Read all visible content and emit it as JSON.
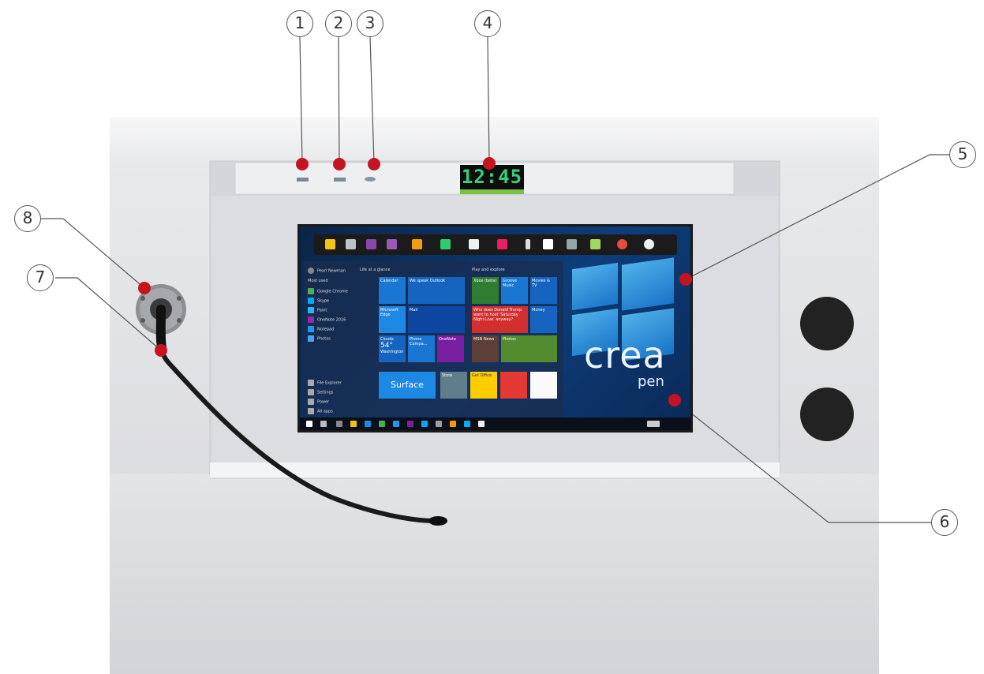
{
  "callouts": [
    {
      "id": "1",
      "label": "1"
    },
    {
      "id": "2",
      "label": "2"
    },
    {
      "id": "3",
      "label": "3"
    },
    {
      "id": "4",
      "label": "4"
    },
    {
      "id": "5",
      "label": "5"
    },
    {
      "id": "6",
      "label": "6"
    },
    {
      "id": "7",
      "label": "7"
    },
    {
      "id": "8",
      "label": "8"
    }
  ],
  "clock": {
    "time": "12:45"
  },
  "screen": {
    "brand_main": "crea",
    "brand_sub": "pen",
    "tiles": {
      "outlook": "We speak Outlook",
      "calendar": "Calendar",
      "mail": "Mail",
      "edge": "Microsoft Edge",
      "surface": "Surface",
      "weather_temp": "54°",
      "weather_city": "Washington",
      "weather_label": "Clouds",
      "onenote": "OneNote",
      "phone": "Phone Compa...",
      "xbox": "Xbox (beta)",
      "groove": "Groove Music",
      "movies": "Movies & TV",
      "news": "Who does Donald Trump want to host 'Saturday Night Live' anyway?",
      "money": "Money",
      "store": "Store",
      "photos": "Photos",
      "msnews": "MSN News",
      "tips": "Get Office"
    },
    "menu": [
      "Pearl Newman",
      "Most used",
      "Google Chrome",
      "Skype",
      "Paint",
      "OneNote 2016",
      "Notepad",
      "Photos",
      "File Explorer",
      "Settings",
      "Power",
      "All apps"
    ],
    "menu_headers": {
      "life": "Life at a glance",
      "play": "Play and explore"
    }
  },
  "colors": {
    "accent_red": "#c41422",
    "panel": "#e9eaec",
    "clock_green": "#33d17a",
    "clock_bar": "#7ac142"
  }
}
